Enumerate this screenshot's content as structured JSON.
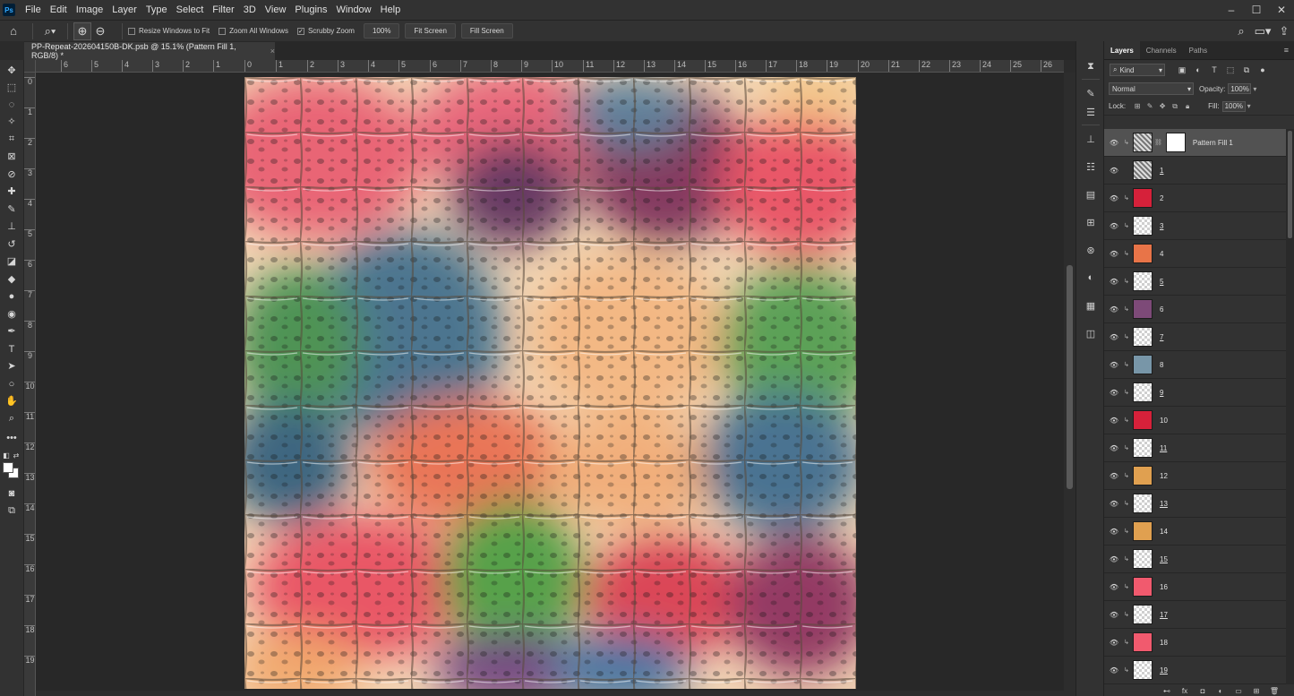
{
  "menu": [
    "File",
    "Edit",
    "Image",
    "Layer",
    "Type",
    "Select",
    "Filter",
    "3D",
    "View",
    "Plugins",
    "Window",
    "Help"
  ],
  "window_controls": {
    "minimize": "–",
    "maximize": "☐",
    "close": "✕"
  },
  "options": {
    "resize_windows": "Resize Windows to Fit",
    "zoom_all": "Zoom All Windows",
    "scrubby_zoom": "Scrubby Zoom",
    "zoom_value": "100%",
    "fit_screen": "Fit Screen",
    "fill_screen": "Fill Screen"
  },
  "document_tab": {
    "title": "PP-Repeat-202604150B-DK.psb @ 15.1% (Pattern Fill 1, RGB/8) *",
    "close": "×"
  },
  "ruler_top": [
    "6",
    "5",
    "4",
    "3",
    "2",
    "1",
    "0",
    "1",
    "2",
    "3",
    "4",
    "5",
    "6",
    "7",
    "8",
    "9",
    "10",
    "11",
    "12",
    "13",
    "14",
    "15",
    "16",
    "17",
    "18",
    "19",
    "20",
    "21",
    "22",
    "23",
    "24",
    "25",
    "26"
  ],
  "ruler_left": [
    "0",
    "1",
    "2",
    "3",
    "4",
    "5",
    "6",
    "7",
    "8",
    "9",
    "10",
    "11",
    "12",
    "13",
    "14",
    "15",
    "16",
    "17",
    "18",
    "19"
  ],
  "layers_panel": {
    "tabs": [
      "Layers",
      "Channels",
      "Paths"
    ],
    "kind": "Kind",
    "blend_mode": "Normal",
    "opacity_label": "Opacity:",
    "opacity": "100%",
    "lock_label": "Lock:",
    "fill_label": "Fill:",
    "fill": "100%",
    "layers": [
      {
        "name": "Pattern Fill 1",
        "thumb": "pattern",
        "color": "",
        "selected": true
      },
      {
        "name": "1",
        "thumb": "pattern",
        "color": ""
      },
      {
        "name": "2",
        "thumb": "color",
        "color": "#d6213a"
      },
      {
        "name": "3",
        "thumb": "trans",
        "color": ""
      },
      {
        "name": "4",
        "thumb": "color",
        "color": "#e87448"
      },
      {
        "name": "5",
        "thumb": "trans",
        "color": ""
      },
      {
        "name": "6",
        "thumb": "color",
        "color": "#7d4a78"
      },
      {
        "name": "7",
        "thumb": "trans",
        "color": ""
      },
      {
        "name": "8",
        "thumb": "color",
        "color": "#7896a8"
      },
      {
        "name": "9",
        "thumb": "trans",
        "color": ""
      },
      {
        "name": "10",
        "thumb": "color",
        "color": "#d6213a"
      },
      {
        "name": "11",
        "thumb": "trans",
        "color": ""
      },
      {
        "name": "12",
        "thumb": "color",
        "color": "#e0a050"
      },
      {
        "name": "13",
        "thumb": "trans",
        "color": ""
      },
      {
        "name": "14",
        "thumb": "color",
        "color": "#e0a050"
      },
      {
        "name": "15",
        "thumb": "trans",
        "color": ""
      },
      {
        "name": "16",
        "thumb": "color",
        "color": "#f15a6e"
      },
      {
        "name": "17",
        "thumb": "trans",
        "color": ""
      },
      {
        "name": "18",
        "thumb": "color",
        "color": "#f15a6e"
      },
      {
        "name": "19",
        "thumb": "trans",
        "color": ""
      }
    ]
  }
}
